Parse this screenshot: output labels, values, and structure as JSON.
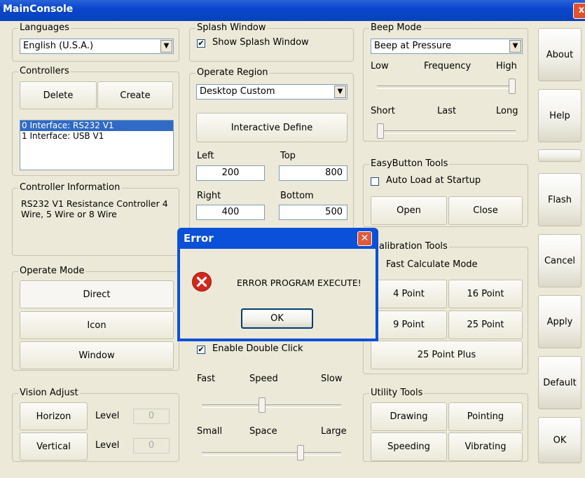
{
  "window": {
    "title": "MainConsole",
    "close_glyph": "x"
  },
  "languages": {
    "title": "Languages",
    "selected": "English (U.S.A.)"
  },
  "controllers": {
    "title": "Controllers",
    "delete_label": "Delete",
    "create_label": "Create",
    "items": [
      "0 Interface: RS232 V1",
      "1 Interface: USB V1"
    ]
  },
  "controller_info": {
    "title": "Controller Information",
    "text_line1": "RS232 V1 Resistance Controller 4",
    "text_line2": "Wire, 5 Wire or 8 Wire"
  },
  "operate_mode": {
    "title": "Operate Mode",
    "direct": "Direct",
    "icon": "Icon",
    "window": "Window"
  },
  "vision_adjust": {
    "title": "Vision Adjust",
    "horizon": "Horizon",
    "vertical": "Vertical",
    "level_label": "Level",
    "horizon_level": "0",
    "vertical_level": "0"
  },
  "splash": {
    "title": "Splash Window",
    "show_label": "Show Splash Window",
    "checked": true
  },
  "operate_region": {
    "title": "Operate Region",
    "selected": "Desktop Custom",
    "define_label": "Interactive Define",
    "left_label": "Left",
    "top_label": "Top",
    "right_label": "Right",
    "bottom_label": "Bottom",
    "left": "200",
    "top": "800",
    "right": "400",
    "bottom": "500"
  },
  "double_click": {
    "enable_label": "Enable Double Click",
    "checked": true,
    "fast": "Fast",
    "speed": "Speed",
    "slow": "Slow",
    "small": "Small",
    "space": "Space",
    "large": "Large",
    "speed_level": 0.43,
    "space_level": 0.72
  },
  "beep": {
    "title": "Beep Mode",
    "selected": "Beep at Pressure",
    "low": "Low",
    "frequency": "Frequency",
    "high": "High",
    "short": "Short",
    "last": "Last",
    "long": "Long",
    "frequency_level": 1.0,
    "last_level": 0.0
  },
  "easybutton": {
    "title": "EasyButton Tools",
    "auto_load": "Auto Load at Startup",
    "open": "Open",
    "close": "Close"
  },
  "calibration": {
    "title_visible": "alibration Tools",
    "fast_calc": "Fast Calculate Mode",
    "p4": "4 Point",
    "p16": "16 Point",
    "p9": "9 Point",
    "p25": "25 Point",
    "p25plus": "25 Point Plus"
  },
  "utility": {
    "title": "Utility Tools",
    "drawing": "Drawing",
    "pointing": "Pointing",
    "speeding": "Speeding",
    "vibrating": "Vibrating"
  },
  "right_buttons": {
    "about": "About",
    "help": "Help",
    "flash": "Flash",
    "cancel": "Cancel",
    "apply": "Apply",
    "default": "Default",
    "ok": "OK"
  },
  "error_dialog": {
    "title": "Error",
    "message": "ERROR PROGRAM EXECUTE!",
    "ok_label": "OK",
    "close_glyph": "✕"
  },
  "colors": {
    "titlebar": "#0a46cf",
    "selection": "#316ac5",
    "face": "#ece9d8",
    "error_icon": "#d5261a"
  }
}
